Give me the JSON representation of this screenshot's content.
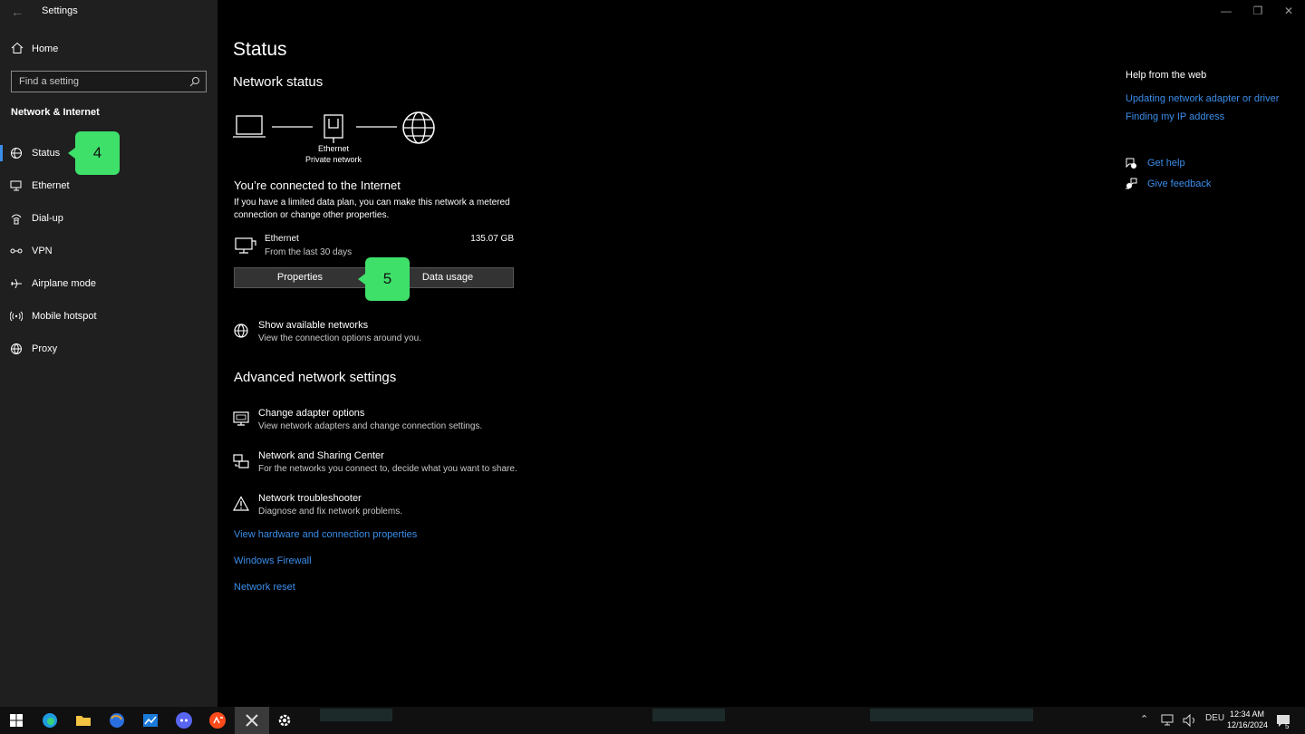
{
  "window": {
    "title": "Settings",
    "back_icon": "back-arrow-icon"
  },
  "sidebar": {
    "home_label": "Home",
    "search_placeholder": "Find a setting",
    "section_title": "Network & Internet",
    "items": [
      {
        "label": "Status",
        "icon": "status-globe-icon",
        "active": true
      },
      {
        "label": "Ethernet",
        "icon": "ethernet-icon"
      },
      {
        "label": "Dial-up",
        "icon": "dialup-icon"
      },
      {
        "label": "VPN",
        "icon": "vpn-icon"
      },
      {
        "label": "Airplane mode",
        "icon": "airplane-icon"
      },
      {
        "label": "Mobile hotspot",
        "icon": "hotspot-icon"
      },
      {
        "label": "Proxy",
        "icon": "proxy-globe-icon"
      }
    ]
  },
  "callouts": {
    "status_step": "4",
    "properties_step": "5",
    "color": "#3ee06a"
  },
  "main": {
    "title": "Status",
    "network_status_heading": "Network status",
    "diagram": {
      "adapter_label": "Ethernet",
      "network_label": "Private network"
    },
    "connected_title": "You’re connected to the Internet",
    "connected_desc": "If you have a limited data plan, you can make this network a metered connection or change other properties.",
    "ethernet": {
      "name": "Ethernet",
      "period": "From the last 30 days",
      "usage": "135.07 GB"
    },
    "buttons": {
      "properties": "Properties",
      "data_usage": "Data usage"
    },
    "show_networks": {
      "title": "Show available networks",
      "desc": "View the connection options around you."
    },
    "advanced_heading": "Advanced network settings",
    "advanced_items": [
      {
        "title": "Change adapter options",
        "desc": "View network adapters and change connection settings.",
        "icon": "adapter-monitor-icon"
      },
      {
        "title": "Network and Sharing Center",
        "desc": "For the networks you connect to, decide what you want to share.",
        "icon": "sharing-center-icon"
      },
      {
        "title": "Network troubleshooter",
        "desc": "Diagnose and fix network problems.",
        "icon": "warning-triangle-icon"
      }
    ],
    "links": [
      "View hardware and connection properties",
      "Windows Firewall",
      "Network reset"
    ]
  },
  "help": {
    "title": "Help from the web",
    "links": [
      "Updating network adapter or driver",
      "Finding my IP address"
    ],
    "get_help": "Get help",
    "give_feedback": "Give feedback"
  },
  "taskbar": {
    "language": "DEU",
    "time": "12:34 AM",
    "date": "12/16/2024",
    "notification_count": "5"
  },
  "colors": {
    "accent": "#3b8eea",
    "sidebar_bg": "#1f1f1f",
    "main_bg": "#000000"
  }
}
